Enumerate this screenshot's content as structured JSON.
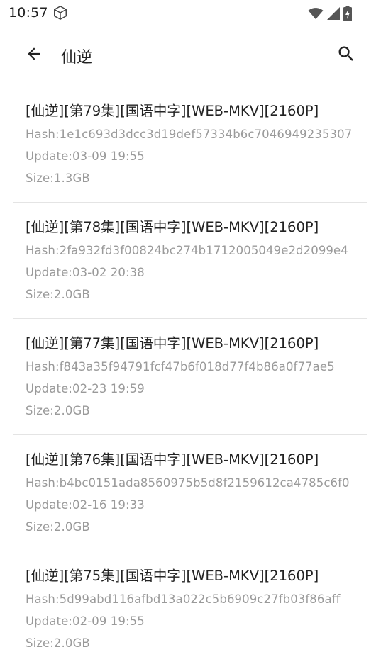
{
  "status_bar": {
    "time": "10:57"
  },
  "app_bar": {
    "title": "仙逆"
  },
  "items": [
    {
      "title": "[仙逆][第79集][国语中字][WEB-MKV][2160P]",
      "hash": "Hash:1e1c693d3dcc3d19def57334b6c7046949235307",
      "update": "Update:03-09 19:55",
      "size": "Size:1.3GB"
    },
    {
      "title": "[仙逆][第78集][国语中字][WEB-MKV][2160P]",
      "hash": "Hash:2fa932fd3f00824bc274b1712005049e2d2099e4",
      "update": "Update:03-02 20:38",
      "size": "Size:2.0GB"
    },
    {
      "title": "[仙逆][第77集][国语中字][WEB-MKV][2160P]",
      "hash": "Hash:f843a35f94791fcf47b6f018d77f4b86a0f77ae5",
      "update": "Update:02-23 19:59",
      "size": "Size:2.0GB"
    },
    {
      "title": "[仙逆][第76集][国语中字][WEB-MKV][2160P]",
      "hash": "Hash:b4bc0151ada8560975b5d8f2159612ca4785c6f0",
      "update": "Update:02-16 19:33",
      "size": "Size:2.0GB"
    },
    {
      "title": "[仙逆][第75集][国语中字][WEB-MKV][2160P]",
      "hash": "Hash:5d99abd116afbd13a022c5b6909c27fb03f86aff",
      "update": "Update:02-09 19:55",
      "size": "Size:2.0GB"
    }
  ],
  "icons": {
    "status_app": "cube-icon",
    "wifi": "wifi-icon",
    "signal": "signal-icon",
    "battery": "battery-icon",
    "back": "arrow-back-icon",
    "search": "search-icon"
  },
  "colors": {
    "background": "#ffffff",
    "text_primary": "#222222",
    "text_secondary": "#9a9a9a",
    "divider": "#e4e4e4"
  }
}
